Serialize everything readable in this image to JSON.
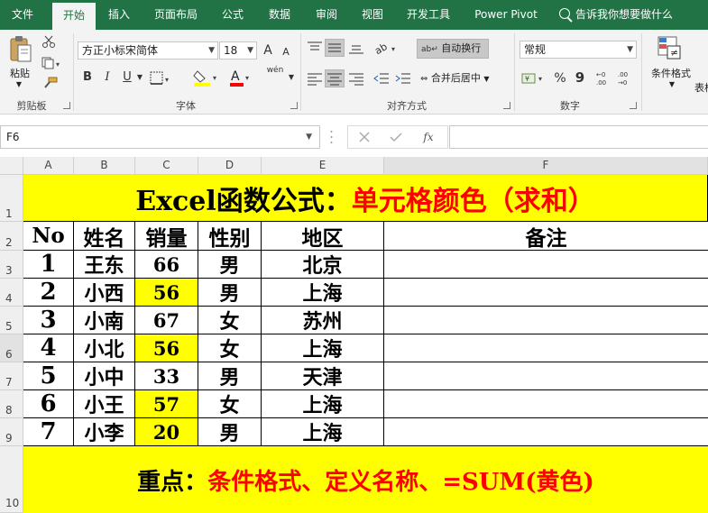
{
  "ribbon_tabs": [
    "文件",
    "开始",
    "插入",
    "页面布局",
    "公式",
    "数据",
    "审阅",
    "视图",
    "开发工具",
    "Power Pivot"
  ],
  "tell_me": "告诉我你想要做什么",
  "clipboard": {
    "paste": "粘贴",
    "label": "剪贴板"
  },
  "font": {
    "name": "方正小标宋简体",
    "size": "18",
    "label": "字体",
    "bold": "B",
    "italic": "I",
    "underline": "U",
    "grow": "A",
    "shrink": "A",
    "font_color_glyph": "A",
    "phonetic": "wén"
  },
  "alignment": {
    "wrap_text": "自动换行",
    "merge_center": "合并后居中",
    "label": "对齐方式"
  },
  "number": {
    "format": "常规",
    "label": "数字",
    "percent": "%",
    "comma": "9"
  },
  "styles": {
    "conditional_format": "条件格式",
    "table_format_partial": "表格"
  },
  "name_box": "F6",
  "formula_bar": {
    "fx": "fx",
    "value": ""
  },
  "columns": [
    "A",
    "B",
    "C",
    "D",
    "E",
    "F"
  ],
  "rows": [
    "1",
    "2",
    "3",
    "4",
    "5",
    "6",
    "7",
    "8",
    "9",
    "10"
  ],
  "sheet": {
    "title_black": "Excel函数公式：",
    "title_red": "单元格颜色（求和）",
    "headers": [
      "No",
      "姓名",
      "销量",
      "性别",
      "地区",
      "备注"
    ],
    "data": [
      {
        "no": "1",
        "name": "王东",
        "sales": "66",
        "gender": "男",
        "region": "北京",
        "note": "",
        "highlight": false
      },
      {
        "no": "2",
        "name": "小西",
        "sales": "56",
        "gender": "男",
        "region": "上海",
        "note": "",
        "highlight": true
      },
      {
        "no": "3",
        "name": "小南",
        "sales": "67",
        "gender": "女",
        "region": "苏州",
        "note": "",
        "highlight": false
      },
      {
        "no": "4",
        "name": "小北",
        "sales": "56",
        "gender": "女",
        "region": "上海",
        "note": "",
        "highlight": true
      },
      {
        "no": "5",
        "name": "小中",
        "sales": "33",
        "gender": "男",
        "region": "天津",
        "note": "",
        "highlight": false
      },
      {
        "no": "6",
        "name": "小王",
        "sales": "57",
        "gender": "女",
        "region": "上海",
        "note": "",
        "highlight": true
      },
      {
        "no": "7",
        "name": "小李",
        "sales": "20",
        "gender": "男",
        "region": "上海",
        "note": "",
        "highlight": true
      }
    ],
    "footer_black": "重点：",
    "footer_red": "条件格式、定义名称、=SUM(黄色)"
  },
  "colors": {
    "excel_green": "#217346",
    "highlight_yellow": "#ffff00",
    "title_red": "#ff0000"
  }
}
